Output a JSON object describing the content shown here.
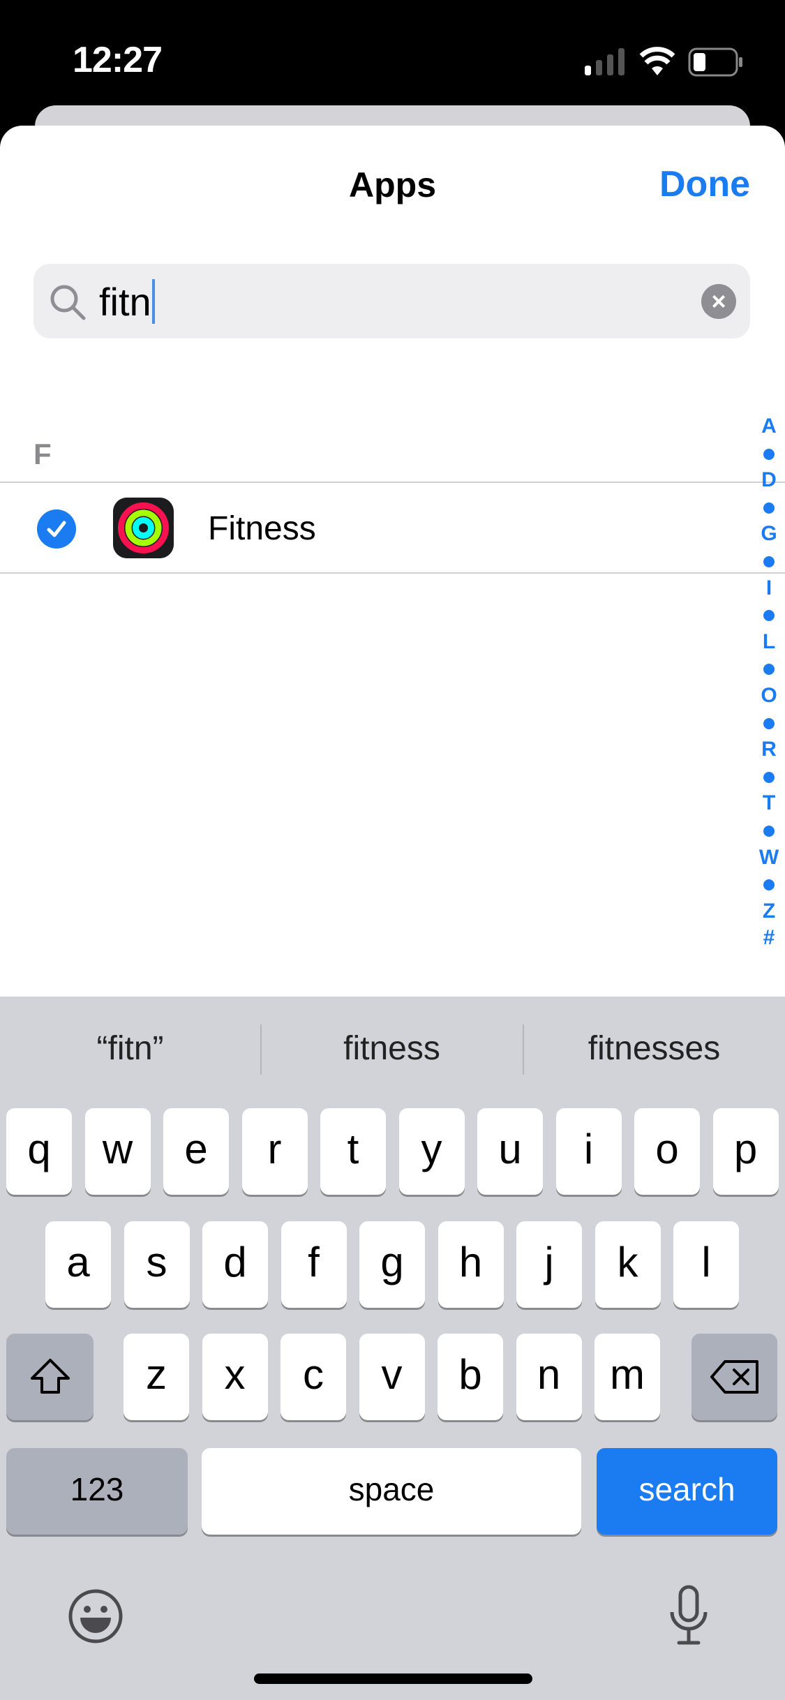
{
  "status_bar": {
    "time": "12:27",
    "icons": [
      "cellular-signal-icon",
      "wifi-icon",
      "battery-icon"
    ]
  },
  "header": {
    "title": "Apps",
    "done_label": "Done"
  },
  "search": {
    "value": "fitn",
    "clear_icon": "clear-icon"
  },
  "list": {
    "section": "F",
    "items": [
      {
        "label": "Fitness",
        "selected": true,
        "icon": "fitness-rings-icon"
      }
    ]
  },
  "index": [
    "A",
    "•",
    "D",
    "•",
    "G",
    "•",
    "I",
    "•",
    "L",
    "•",
    "O",
    "•",
    "R",
    "•",
    "T",
    "•",
    "W",
    "•",
    "Z",
    "#"
  ],
  "keyboard": {
    "suggestions": [
      "“fitn”",
      "fitness",
      "fitnesses"
    ],
    "row1": [
      "q",
      "w",
      "e",
      "r",
      "t",
      "y",
      "u",
      "i",
      "o",
      "p"
    ],
    "row2": [
      "a",
      "s",
      "d",
      "f",
      "g",
      "h",
      "j",
      "k",
      "l"
    ],
    "row3": [
      "z",
      "x",
      "c",
      "v",
      "b",
      "n",
      "m"
    ],
    "numbers_label": "123",
    "space_label": "space",
    "search_label": "search"
  },
  "colors": {
    "accent": "#1a7cf0",
    "keyboard_bg": "#d1d3d9"
  }
}
